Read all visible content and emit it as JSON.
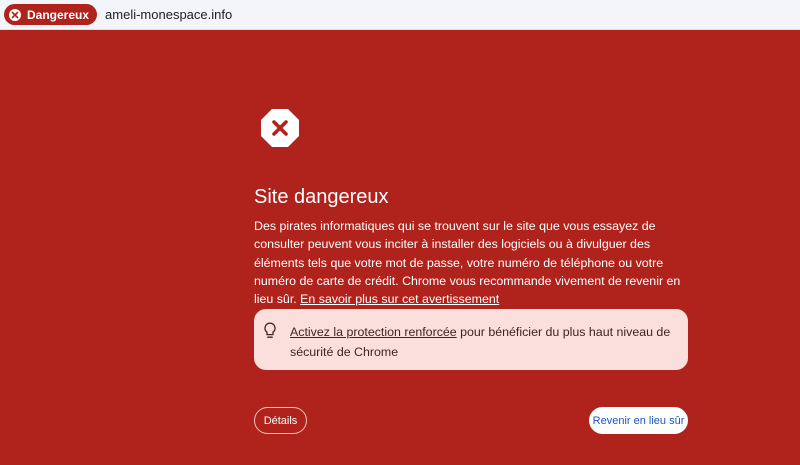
{
  "omnibox": {
    "badge_label": "Dangereux",
    "url": "ameli-monespace.info"
  },
  "interstitial": {
    "title": "Site dangereux",
    "description": "Des pirates informatiques qui se trouvent sur le site que vous essayez de consulter peuvent vous inciter à installer des logiciels ou à divulguer des éléments tels que votre mot de passe, votre numéro de téléphone ou votre numéro de carte de crédit. Chrome vous recommande vivement de revenir en lieu sûr.",
    "learn_more_link": "En savoir plus sur cet avertissement",
    "tip": {
      "link": "Activez la protection renforcée",
      "text": " pour bénéficier du plus haut niveau de sécurité de Chrome"
    },
    "details_button": "Détails",
    "back_button": "Revenir en lieu sûr"
  },
  "colors": {
    "background": "#b0231c",
    "tip_background": "#fbdfdc",
    "back_button_text": "#1a56c4"
  },
  "icons": {
    "badge": "close-circle-icon",
    "warning": "danger-octagon-icon",
    "tip": "lightbulb-icon"
  }
}
